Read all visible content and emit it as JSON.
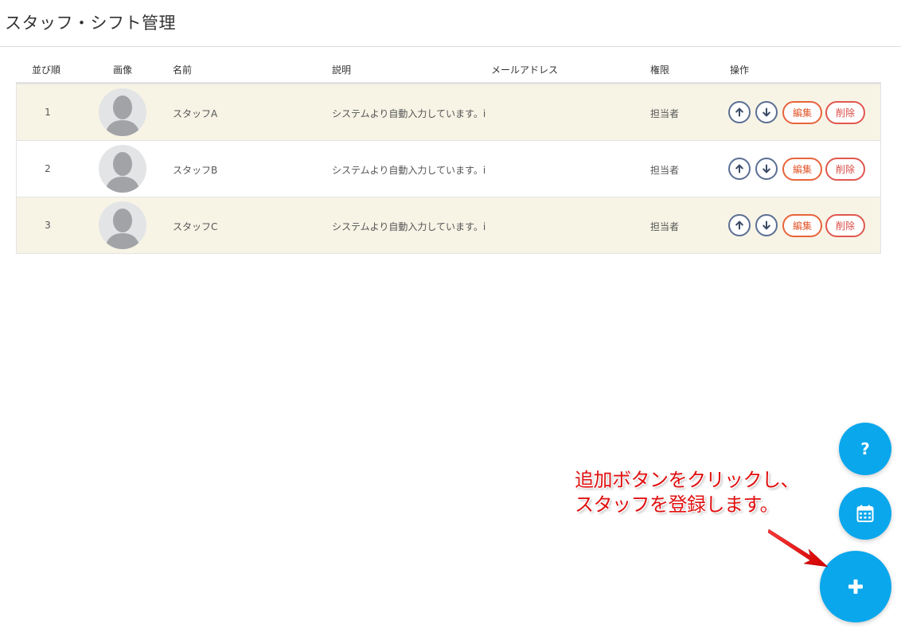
{
  "page": {
    "title": "スタッフ・シフト管理"
  },
  "table": {
    "headers": {
      "order": "並び順",
      "image": "画像",
      "name": "名前",
      "description": "説明",
      "email": "メールアドレス",
      "role": "権限",
      "actions": "操作"
    },
    "rows": [
      {
        "order": "1",
        "name": "スタッフA",
        "description": "システムより自動入力しています。i",
        "email": "",
        "role": "担当者",
        "edit_label": "編集",
        "delete_label": "削除",
        "shaded": true
      },
      {
        "order": "2",
        "name": "スタッフB",
        "description": "システムより自動入力しています。i",
        "email": "",
        "role": "担当者",
        "edit_label": "編集",
        "delete_label": "削除",
        "shaded": false
      },
      {
        "order": "3",
        "name": "スタッフC",
        "description": "システムより自動入力しています。i",
        "email": "",
        "role": "担当者",
        "edit_label": "編集",
        "delete_label": "削除",
        "shaded": true
      }
    ]
  },
  "fab": {
    "help_label": "?",
    "calendar_icon": "calendar-icon",
    "add_icon": "plus-icon",
    "color": "#0aa7ec"
  },
  "annotation": {
    "line1": "追加ボタンをクリックし、",
    "line2": "スタッフを登録します。",
    "color": "#e01010"
  },
  "colors": {
    "row_shaded": "#f7f4e6",
    "arrow_button": "#5b6f93",
    "edit_button": "#e8643a",
    "delete_button": "#e0574f"
  }
}
